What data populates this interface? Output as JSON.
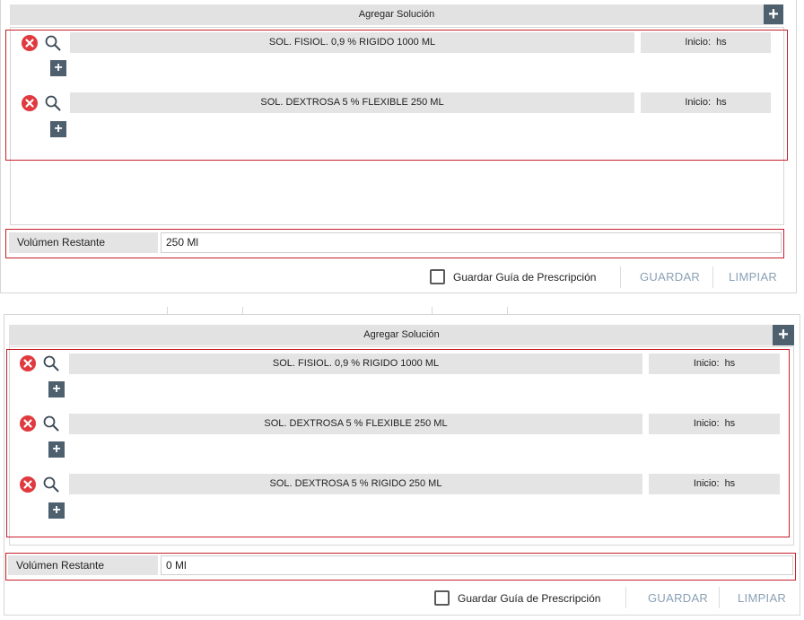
{
  "panel1": {
    "header": "Agregar Solución",
    "solutions": [
      {
        "name": "SOL. FISIOL. 0,9 % RIGIDO 1000 ML",
        "inicio_label": "Inicio:",
        "inicio_unit": "hs"
      },
      {
        "name": "SOL. DEXTROSA 5 % FLEXIBLE 250 ML",
        "inicio_label": "Inicio:",
        "inicio_unit": "hs"
      }
    ],
    "volume_label": "Volúmen Restante",
    "volume_value": "250 Ml",
    "save_guide_label": "Guardar Guía de Prescripción",
    "save_label": "GUARDAR",
    "clear_label": "LIMPIAR"
  },
  "panel2": {
    "header": "Agregar Solución",
    "solutions": [
      {
        "name": "SOL. FISIOL. 0,9 % RIGIDO 1000 ML",
        "inicio_label": "Inicio:",
        "inicio_unit": "hs"
      },
      {
        "name": "SOL. DEXTROSA 5 % FLEXIBLE 250 ML",
        "inicio_label": "Inicio:",
        "inicio_unit": "hs"
      },
      {
        "name": "SOL. DEXTROSA 5 % RIGIDO 250 ML",
        "inicio_label": "Inicio:",
        "inicio_unit": "hs"
      }
    ],
    "volume_label": "Volúmen Restante",
    "volume_value": "0 Ml",
    "save_guide_label": "Guardar Guía de Prescripción",
    "save_label": "GUARDAR",
    "clear_label": "LIMPIAR"
  },
  "icons": {
    "remove": "remove-circle-icon",
    "search": "search-icon",
    "add": "plus-icon"
  },
  "colors": {
    "remove_red": "#e0393e",
    "add_button": "#4e5f6e",
    "highlight_border": "#c81e2a",
    "action_text": "#8aa0b6"
  }
}
